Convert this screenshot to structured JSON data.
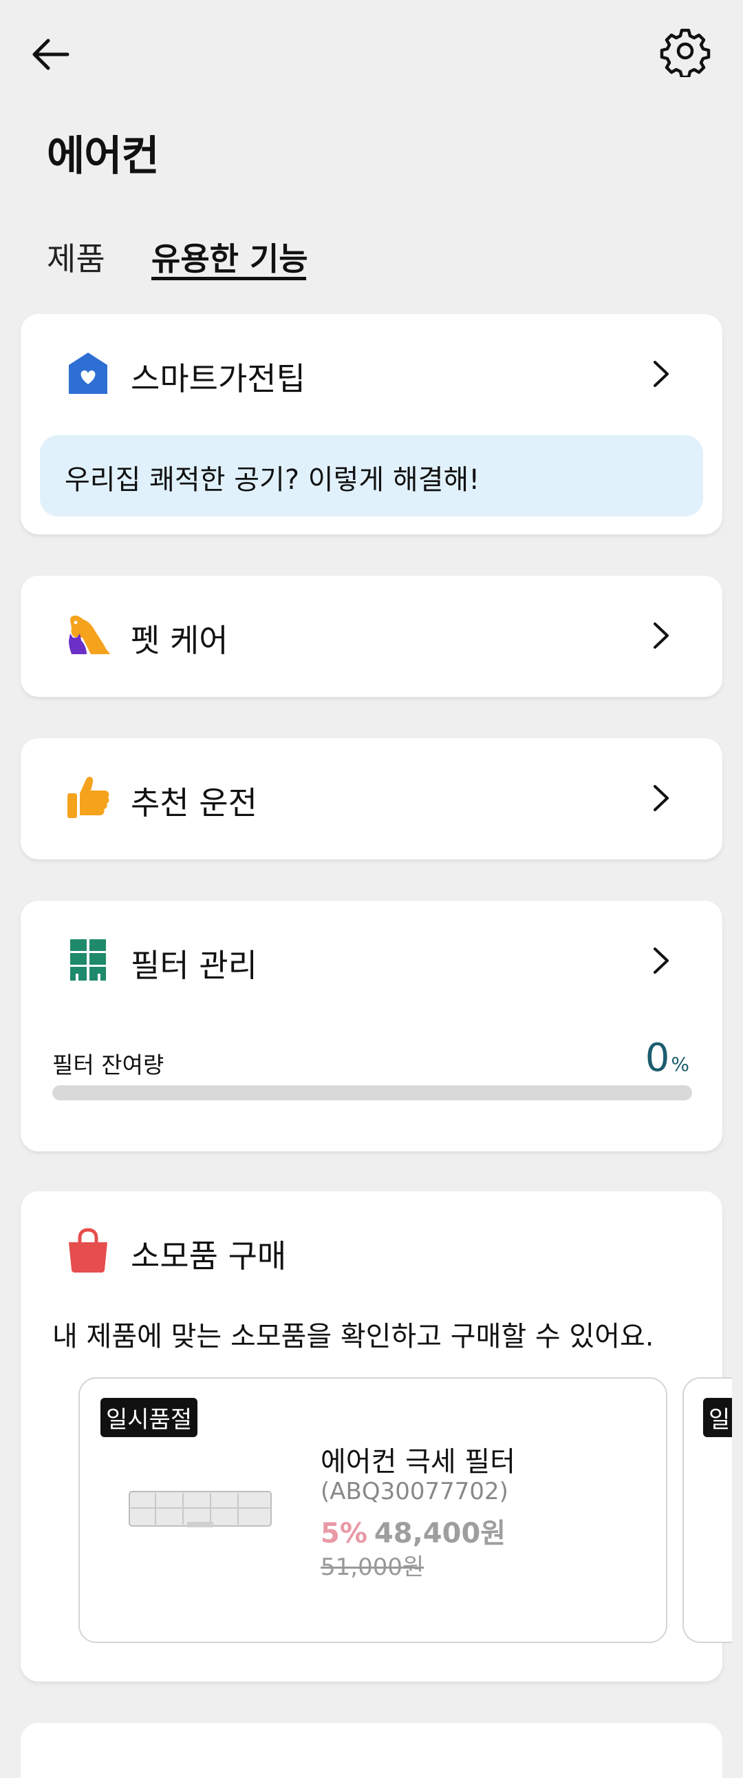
{
  "header": {
    "title": "에어컨",
    "back_icon": "arrow-left-icon",
    "settings_icon": "gear-icon"
  },
  "tabs": [
    {
      "label": "제품",
      "selected": false
    },
    {
      "label": "유용한 기능",
      "selected": true
    }
  ],
  "cards": {
    "smart_tip": {
      "icon": "house-heart-icon",
      "title": "스마트가전팁",
      "banner": "우리집 쾌적한 공기? 이렇게 해결해!"
    },
    "pet_care": {
      "icon": "pet-icon",
      "title": "펫 케어"
    },
    "recommended": {
      "icon": "thumbs-up-icon",
      "title": "추천 운전"
    },
    "filter": {
      "icon": "filter-grid-icon",
      "title": "필터 관리",
      "remaining_label": "필터 잔여량",
      "remaining_value": "0",
      "remaining_unit": "%",
      "remaining_fraction": 0
    },
    "shop": {
      "icon": "shopping-bag-icon",
      "title": "소모품 구매",
      "description": "내 제품에 맞는 소모품을 확인하고 구매할 수 있어요.",
      "products": [
        {
          "badge": "일시품절",
          "name": "에어컨 극세 필터",
          "code": "(ABQ30077702)",
          "discount": "5%",
          "price": "48,400원",
          "original_price": "51,000원"
        },
        {
          "badge": "일"
        }
      ]
    }
  },
  "colors": {
    "background": "#efefef",
    "card": "#ffffff",
    "banner": "#e1f1fb",
    "accent_teal": "#1b5d6e",
    "discount_pink": "#e899a6",
    "icon_blue": "#2f6fd4",
    "icon_orange": "#f5a21c",
    "icon_green": "#1f8a6b",
    "icon_red": "#e64d4d"
  }
}
